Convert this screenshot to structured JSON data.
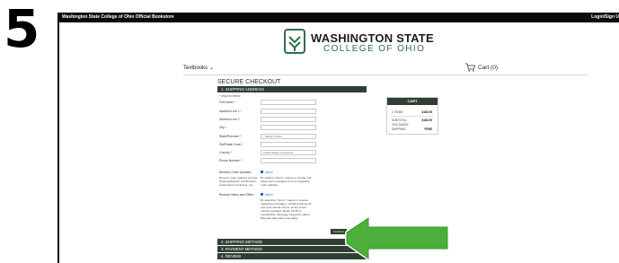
{
  "step_number": "5",
  "topbar": {
    "store_name": "Washington State College of Ohio Official Bookstore",
    "login_link": "Login/Sign U"
  },
  "logo": {
    "line1": "WASHINGTON STATE",
    "line2": "COLLEGE OF OHIO"
  },
  "nav": {
    "textbooks": "Textbooks",
    "cart": "Cart (0)"
  },
  "checkout": {
    "title": "SECURE CHECKOUT",
    "sections": {
      "shipping_address": "1. SHIPPING ADDRESS",
      "shipping_method": "2. SHIPPING METHOD",
      "payment_method": "3. PAYMENT METHOD",
      "review": "4. REVIEW"
    },
    "required_note": "* required fields",
    "fields": {
      "full_name": "Full Name *",
      "address1": "Address Line 1 *",
      "address2": "Address Line 2",
      "city": "City *",
      "state": "State/Province *",
      "state_value": "- Select a State -",
      "zip": "Zip/Postal Code *",
      "country": "Country *",
      "country_value": "United States of America",
      "phone": "Phone Number *"
    },
    "updates": {
      "label": "Receive Order Updates",
      "sub_label": "Receive order updates such as shipping/delivery confirmation, rental return reminders, etc.",
      "opt_in": "Opt-in",
      "text": "By clicking \"Opt-in\" I agree to receive cell phone text messages from us regarding order updates."
    },
    "news": {
      "label": "Receive News and Offers",
      "opt_in": "Opt-in",
      "text": "By selecting \"Opt-in\" I agree to receive marketing messages, including discounts and promotional events, at the phone number provided. Reply STOP to unsubscribe. Message frequency varies. Msg and data rates may apply."
    },
    "continue_label": "Continue"
  },
  "cart": {
    "title": "CART",
    "rows": [
      {
        "label": "2 ITEMS",
        "value": "$183.99"
      },
      {
        "label": "SUBTOTAL",
        "value": "$183.99"
      },
      {
        "label": "YOU SAVED:",
        "value": ""
      },
      {
        "label": "SHIPPING:",
        "value": "FREE"
      }
    ]
  },
  "colors": {
    "section_bar": "#2f3f33",
    "brand_green": "#2f6d4a",
    "arrow_green": "#4caf3a",
    "link_blue": "#2a5fc7"
  },
  "icons": [
    "cart-icon",
    "chevron-down-icon",
    "college-logo-icon",
    "pointer-arrow-icon"
  ]
}
